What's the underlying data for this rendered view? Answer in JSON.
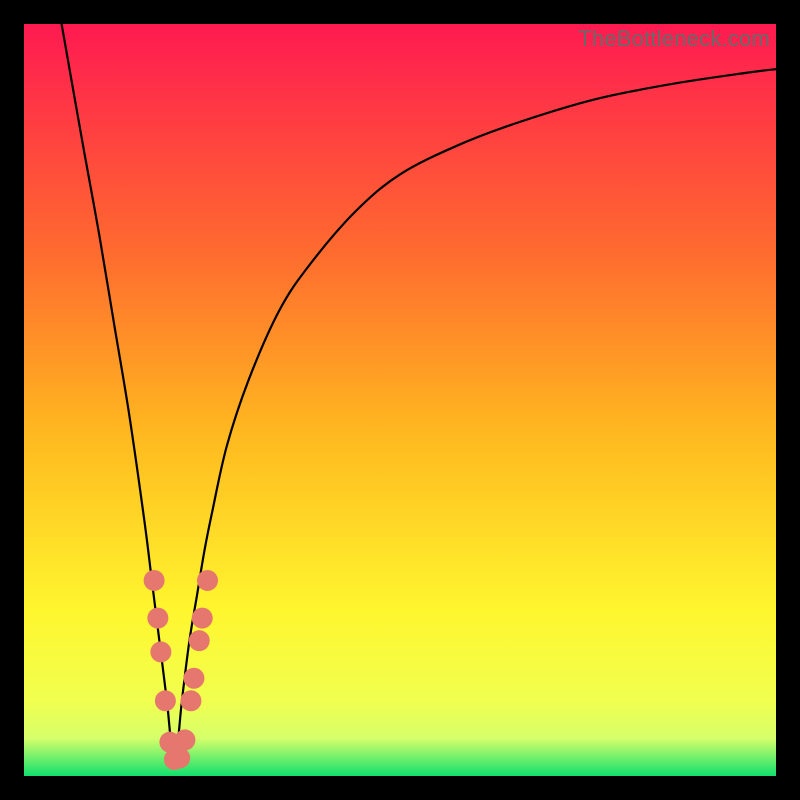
{
  "watermark": "TheBottleneck.com",
  "colors": {
    "frame": "#000000",
    "curve": "#000000",
    "marker_fill": "#e6776e",
    "marker_stroke": "#cf5f57",
    "grad_top": "#ff1a51",
    "grad_mid1": "#ff6a2f",
    "grad_mid2": "#ffba1f",
    "grad_mid3": "#fff62e",
    "grad_mid4": "#f1ff4f",
    "grad_band": "#d6ff6a",
    "grad_bottom": "#11e06d"
  },
  "chart_data": {
    "type": "line",
    "title": "",
    "xlabel": "",
    "ylabel": "",
    "xlim": [
      0,
      100
    ],
    "ylim": [
      0,
      100
    ],
    "x_min_bottleneck": 20,
    "series": [
      {
        "name": "bottleneck-curve",
        "x": [
          5,
          8,
          10,
          12,
          14,
          16,
          17,
          18,
          19,
          19.5,
          20,
          20.5,
          21,
          22,
          23,
          24,
          25,
          27,
          30,
          34,
          38,
          44,
          50,
          58,
          66,
          76,
          86,
          96,
          100
        ],
        "y": [
          100,
          83,
          72,
          60,
          48,
          34,
          26,
          18,
          10,
          5,
          2,
          5,
          10,
          18,
          24,
          30,
          35,
          44,
          53,
          62,
          68,
          75,
          80,
          84,
          87,
          90,
          92,
          93.5,
          94
        ]
      }
    ],
    "markers": {
      "name": "highlight-points",
      "points": [
        {
          "x": 17.3,
          "y": 26
        },
        {
          "x": 17.8,
          "y": 21
        },
        {
          "x": 18.2,
          "y": 16.5
        },
        {
          "x": 18.8,
          "y": 10
        },
        {
          "x": 19.4,
          "y": 4.5
        },
        {
          "x": 20.0,
          "y": 2.2
        },
        {
          "x": 20.7,
          "y": 2.4
        },
        {
          "x": 21.4,
          "y": 4.8
        },
        {
          "x": 22.2,
          "y": 10
        },
        {
          "x": 22.6,
          "y": 13
        },
        {
          "x": 23.3,
          "y": 18
        },
        {
          "x": 23.7,
          "y": 21
        },
        {
          "x": 24.4,
          "y": 26
        }
      ]
    },
    "gradient_stops": [
      {
        "offset": 0.0,
        "key": "grad_top"
      },
      {
        "offset": 0.3,
        "key": "grad_mid1"
      },
      {
        "offset": 0.55,
        "key": "grad_mid2"
      },
      {
        "offset": 0.78,
        "key": "grad_mid3"
      },
      {
        "offset": 0.9,
        "key": "grad_mid4"
      },
      {
        "offset": 0.95,
        "key": "grad_band"
      },
      {
        "offset": 1.0,
        "key": "grad_bottom"
      }
    ]
  }
}
